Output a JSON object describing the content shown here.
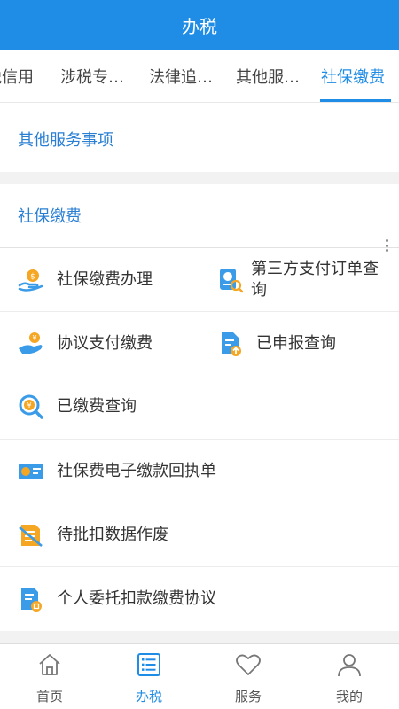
{
  "header": {
    "title": "办税"
  },
  "tabs": [
    {
      "label": "税信用"
    },
    {
      "label": "涉税专…"
    },
    {
      "label": "法律追…"
    },
    {
      "label": "其他服…"
    },
    {
      "label": "社保缴费"
    }
  ],
  "sections": {
    "other": {
      "title": "其他服务事项"
    },
    "social": {
      "title": "社保缴费"
    }
  },
  "menu": {
    "social_payment": "社保缴费办理",
    "third_party_query": "第三方支付订单查询",
    "agreement_payment": "协议支付缴费",
    "declared_query": "已申报查询",
    "paid_query": "已缴费查询",
    "e_receipt": "社保费电子缴款回执单",
    "pending_void": "待批扣数据作废",
    "personal_agreement": "个人委托扣款缴费协议"
  },
  "tabbar": [
    {
      "label": "首页",
      "icon": "home-icon"
    },
    {
      "label": "办税",
      "icon": "list-icon"
    },
    {
      "label": "服务",
      "icon": "heart-icon"
    },
    {
      "label": "我的",
      "icon": "user-icon"
    }
  ],
  "colors": {
    "primary": "#1f8ce6",
    "section_title": "#2a7fd3",
    "icon_orange": "#f5a623",
    "icon_blue": "#3a9be8"
  }
}
